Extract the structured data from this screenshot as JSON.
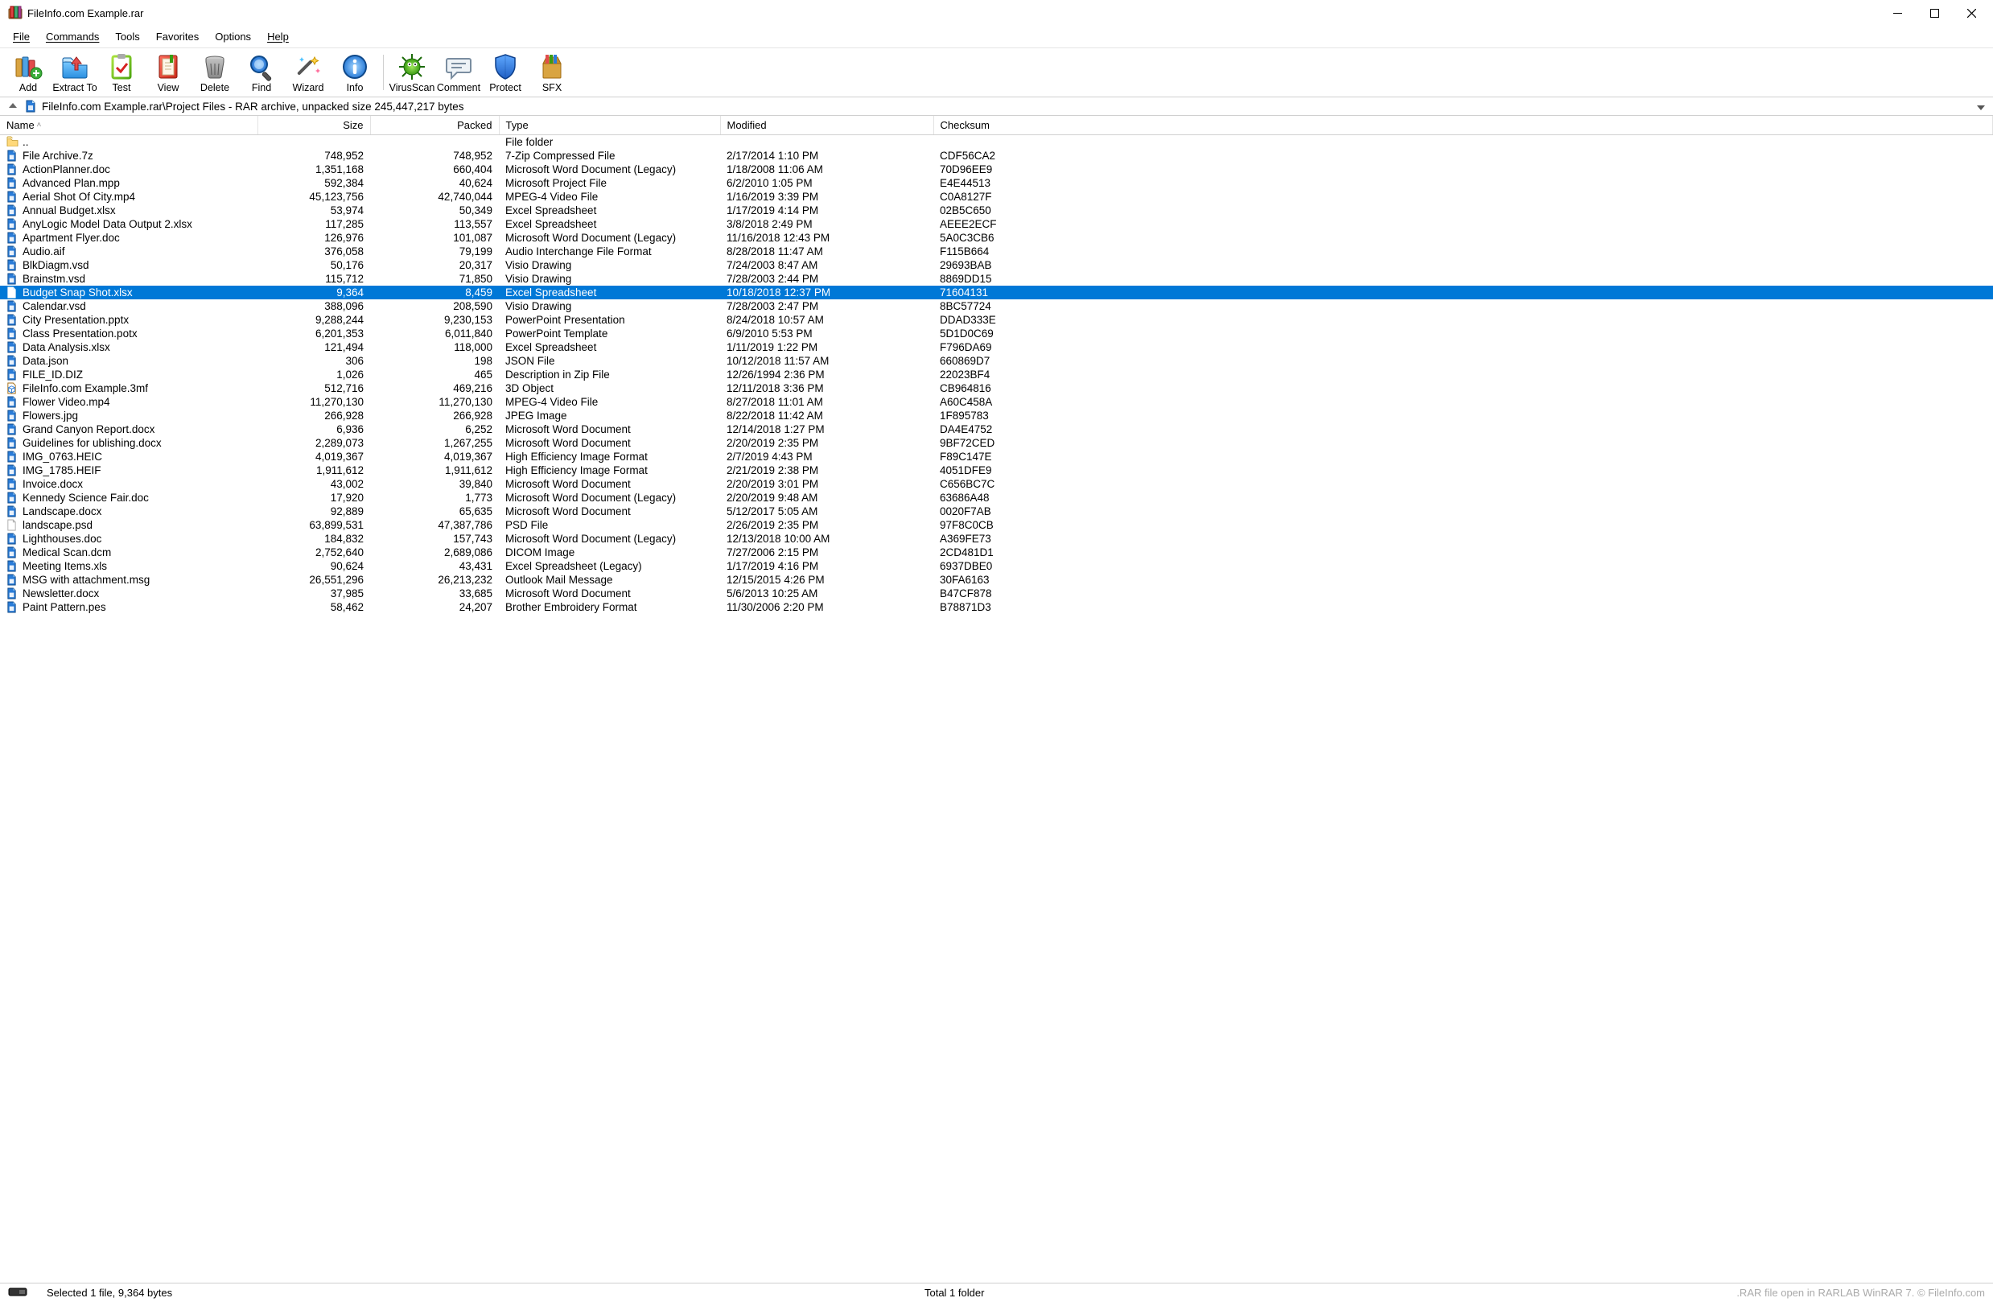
{
  "window": {
    "title": "FileInfo.com Example.rar"
  },
  "menu": {
    "file": "File",
    "commands": "Commands",
    "tools": "Tools",
    "favorites": "Favorites",
    "options": "Options",
    "help": "Help"
  },
  "toolbar": {
    "add": "Add",
    "extract": "Extract To",
    "test": "Test",
    "view": "View",
    "delete": "Delete",
    "find": "Find",
    "wizard": "Wizard",
    "info": "Info",
    "virus": "VirusScan",
    "comment": "Comment",
    "protect": "Protect",
    "sfx": "SFX"
  },
  "address": {
    "path": "FileInfo.com Example.rar\\Project Files - RAR archive, unpacked size 245,447,217 bytes"
  },
  "columns": {
    "name": "Name",
    "size": "Size",
    "packed": "Packed",
    "type": "Type",
    "modified": "Modified",
    "checksum": "Checksum"
  },
  "parent_row_type": "File folder",
  "rows": [
    {
      "name": "File Archive.7z",
      "size": "748,952",
      "packed": "748,952",
      "type": "7-Zip Compressed File",
      "modified": "2/17/2014 1:10 PM",
      "checksum": "CDF56CA2",
      "icon": "generic"
    },
    {
      "name": "ActionPlanner.doc",
      "size": "1,351,168",
      "packed": "660,404",
      "type": "Microsoft Word Document (Legacy)",
      "modified": "1/18/2008 11:06 AM",
      "checksum": "70D96EE9",
      "icon": "generic"
    },
    {
      "name": "Advanced Plan.mpp",
      "size": "592,384",
      "packed": "40,624",
      "type": "Microsoft Project File",
      "modified": "6/2/2010 1:05 PM",
      "checksum": "E4E44513",
      "icon": "generic"
    },
    {
      "name": "Aerial Shot Of City.mp4",
      "size": "45,123,756",
      "packed": "42,740,044",
      "type": "MPEG-4 Video File",
      "modified": "1/16/2019 3:39 PM",
      "checksum": "C0A8127F",
      "icon": "generic"
    },
    {
      "name": "Annual Budget.xlsx",
      "size": "53,974",
      "packed": "50,349",
      "type": "Excel Spreadsheet",
      "modified": "1/17/2019 4:14 PM",
      "checksum": "02B5C650",
      "icon": "generic"
    },
    {
      "name": "AnyLogic Model Data Output 2.xlsx",
      "size": "117,285",
      "packed": "113,557",
      "type": "Excel Spreadsheet",
      "modified": "3/8/2018 2:49 PM",
      "checksum": "AEEE2ECF",
      "icon": "generic"
    },
    {
      "name": "Apartment Flyer.doc",
      "size": "126,976",
      "packed": "101,087",
      "type": "Microsoft Word Document (Legacy)",
      "modified": "11/16/2018 12:43 PM",
      "checksum": "5A0C3CB6",
      "icon": "generic"
    },
    {
      "name": "Audio.aif",
      "size": "376,058",
      "packed": "79,199",
      "type": "Audio Interchange File Format",
      "modified": "8/28/2018 11:47 AM",
      "checksum": "F115B664",
      "icon": "generic"
    },
    {
      "name": "BlkDiagm.vsd",
      "size": "50,176",
      "packed": "20,317",
      "type": "Visio Drawing",
      "modified": "7/24/2003 8:47 AM",
      "checksum": "29693BAB",
      "icon": "generic"
    },
    {
      "name": "Brainstm.vsd",
      "size": "115,712",
      "packed": "71,850",
      "type": "Visio Drawing",
      "modified": "7/28/2003 2:44 PM",
      "checksum": "8869DD15",
      "icon": "generic"
    },
    {
      "name": "Budget Snap Shot.xlsx",
      "size": "9,364",
      "packed": "8,459",
      "type": "Excel Spreadsheet",
      "modified": "10/18/2018 12:37 PM",
      "checksum": "71604131",
      "icon": "generic",
      "selected": true
    },
    {
      "name": "Calendar.vsd",
      "size": "388,096",
      "packed": "208,590",
      "type": "Visio Drawing",
      "modified": "7/28/2003 2:47 PM",
      "checksum": "8BC57724",
      "icon": "generic"
    },
    {
      "name": "City Presentation.pptx",
      "size": "9,288,244",
      "packed": "9,230,153",
      "type": "PowerPoint Presentation",
      "modified": "8/24/2018 10:57 AM",
      "checksum": "DDAD333E",
      "icon": "generic"
    },
    {
      "name": "Class Presentation.potx",
      "size": "6,201,353",
      "packed": "6,011,840",
      "type": "PowerPoint Template",
      "modified": "6/9/2010 5:53 PM",
      "checksum": "5D1D0C69",
      "icon": "generic"
    },
    {
      "name": "Data Analysis.xlsx",
      "size": "121,494",
      "packed": "118,000",
      "type": "Excel Spreadsheet",
      "modified": "1/11/2019 1:22 PM",
      "checksum": "F796DA69",
      "icon": "generic"
    },
    {
      "name": "Data.json",
      "size": "306",
      "packed": "198",
      "type": "JSON File",
      "modified": "10/12/2018 11:57 AM",
      "checksum": "660869D7",
      "icon": "generic"
    },
    {
      "name": "FILE_ID.DIZ",
      "size": "1,026",
      "packed": "465",
      "type": "Description in Zip File",
      "modified": "12/26/1994 2:36 PM",
      "checksum": "22023BF4",
      "icon": "generic"
    },
    {
      "name": "FileInfo.com Example.3mf",
      "size": "512,716",
      "packed": "469,216",
      "type": "3D Object",
      "modified": "12/11/2018 3:36 PM",
      "checksum": "CB964816",
      "icon": "3mf"
    },
    {
      "name": "Flower Video.mp4",
      "size": "11,270,130",
      "packed": "11,270,130",
      "type": "MPEG-4 Video File",
      "modified": "8/27/2018 11:01 AM",
      "checksum": "A60C458A",
      "icon": "generic"
    },
    {
      "name": "Flowers.jpg",
      "size": "266,928",
      "packed": "266,928",
      "type": "JPEG Image",
      "modified": "8/22/2018 11:42 AM",
      "checksum": "1F895783",
      "icon": "generic"
    },
    {
      "name": "Grand Canyon Report.docx",
      "size": "6,936",
      "packed": "6,252",
      "type": "Microsoft Word Document",
      "modified": "12/14/2018 1:27 PM",
      "checksum": "DA4E4752",
      "icon": "generic"
    },
    {
      "name": "Guidelines for ublishing.docx",
      "size": "2,289,073",
      "packed": "1,267,255",
      "type": "Microsoft Word Document",
      "modified": "2/20/2019 2:35 PM",
      "checksum": "9BF72CED",
      "icon": "generic"
    },
    {
      "name": "IMG_0763.HEIC",
      "size": "4,019,367",
      "packed": "4,019,367",
      "type": "High Efficiency Image Format",
      "modified": "2/7/2019 4:43 PM",
      "checksum": "F89C147E",
      "icon": "generic"
    },
    {
      "name": "IMG_1785.HEIF",
      "size": "1,911,612",
      "packed": "1,911,612",
      "type": "High Efficiency Image Format",
      "modified": "2/21/2019 2:38 PM",
      "checksum": "4051DFE9",
      "icon": "generic"
    },
    {
      "name": "Invoice.docx",
      "size": "43,002",
      "packed": "39,840",
      "type": "Microsoft Word Document",
      "modified": "2/20/2019 3:01 PM",
      "checksum": "C656BC7C",
      "icon": "generic"
    },
    {
      "name": "Kennedy Science Fair.doc",
      "size": "17,920",
      "packed": "1,773",
      "type": "Microsoft Word Document (Legacy)",
      "modified": "2/20/2019 9:48 AM",
      "checksum": "63686A48",
      "icon": "generic"
    },
    {
      "name": "Landscape.docx",
      "size": "92,889",
      "packed": "65,635",
      "type": "Microsoft Word Document",
      "modified": "5/12/2017 5:05 AM",
      "checksum": "0020F7AB",
      "icon": "generic"
    },
    {
      "name": "landscape.psd",
      "size": "63,899,531",
      "packed": "47,387,786",
      "type": "PSD File",
      "modified": "2/26/2019 2:35 PM",
      "checksum": "97F8C0CB",
      "icon": "blank"
    },
    {
      "name": "Lighthouses.doc",
      "size": "184,832",
      "packed": "157,743",
      "type": "Microsoft Word Document (Legacy)",
      "modified": "12/13/2018 10:00 AM",
      "checksum": "A369FE73",
      "icon": "generic"
    },
    {
      "name": "Medical Scan.dcm",
      "size": "2,752,640",
      "packed": "2,689,086",
      "type": "DICOM Image",
      "modified": "7/27/2006 2:15 PM",
      "checksum": "2CD481D1",
      "icon": "generic"
    },
    {
      "name": "Meeting Items.xls",
      "size": "90,624",
      "packed": "43,431",
      "type": "Excel Spreadsheet (Legacy)",
      "modified": "1/17/2019 4:16 PM",
      "checksum": "6937DBE0",
      "icon": "generic"
    },
    {
      "name": "MSG with attachment.msg",
      "size": "26,551,296",
      "packed": "26,213,232",
      "type": "Outlook Mail Message",
      "modified": "12/15/2015 4:26 PM",
      "checksum": "30FA6163",
      "icon": "generic"
    },
    {
      "name": "Newsletter.docx",
      "size": "37,985",
      "packed": "33,685",
      "type": "Microsoft Word Document",
      "modified": "5/6/2013 10:25 AM",
      "checksum": "B47CF878",
      "icon": "generic"
    },
    {
      "name": "Paint Pattern.pes",
      "size": "58,462",
      "packed": "24,207",
      "type": "Brother Embroidery Format",
      "modified": "11/30/2006 2:20 PM",
      "checksum": "B78871D3",
      "icon": "generic"
    }
  ],
  "status": {
    "left": "Selected 1 file, 9,364 bytes",
    "center": "Total 1 folder",
    "watermark": ".RAR file open in RARLAB WinRAR 7. © FileInfo.com"
  }
}
